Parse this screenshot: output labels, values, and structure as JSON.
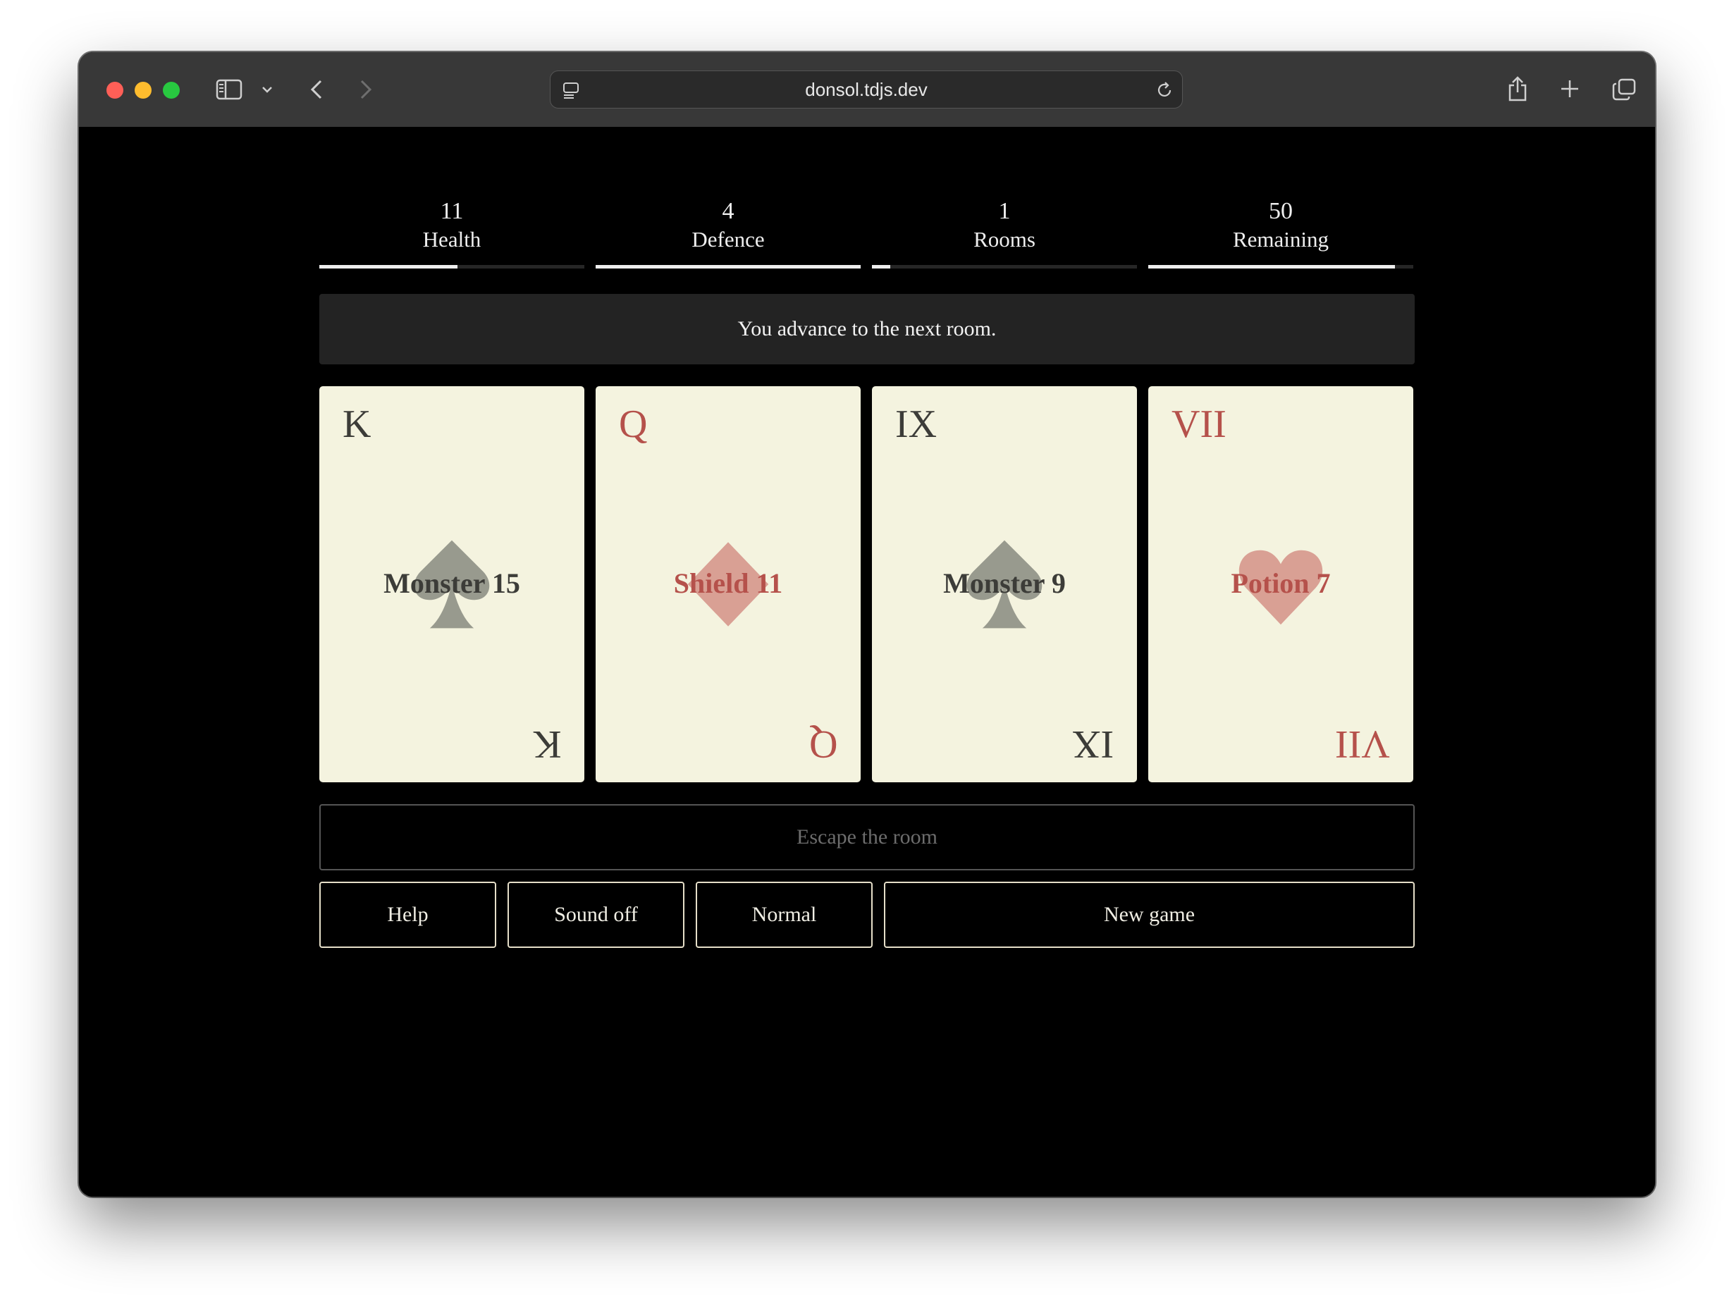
{
  "browser": {
    "url": "donsol.tdjs.dev"
  },
  "stats": [
    {
      "value": "11",
      "label": "Health",
      "fill": 0.52
    },
    {
      "value": "4",
      "label": "Defence",
      "fill": 1.0
    },
    {
      "value": "1",
      "label": "Rooms",
      "fill": 0.07
    },
    {
      "value": "50",
      "label": "Remaining",
      "fill": 0.93
    }
  ],
  "message": "You advance to the next room.",
  "cards": [
    {
      "rank": "K",
      "label": "Monster 15",
      "suit": "spade",
      "color": "#3c3c38"
    },
    {
      "rank": "Q",
      "label": "Shield 11",
      "suit": "diamond",
      "color": "#b5514b"
    },
    {
      "rank": "IX",
      "label": "Monster 9",
      "suit": "spade",
      "color": "#3c3c38"
    },
    {
      "rank": "VII",
      "label": "Potion 7",
      "suit": "heart",
      "color": "#b5514b"
    }
  ],
  "actions": {
    "escape": "Escape the room",
    "help": "Help",
    "sound": "Sound off",
    "difficulty": "Normal",
    "new_game": "New game"
  }
}
